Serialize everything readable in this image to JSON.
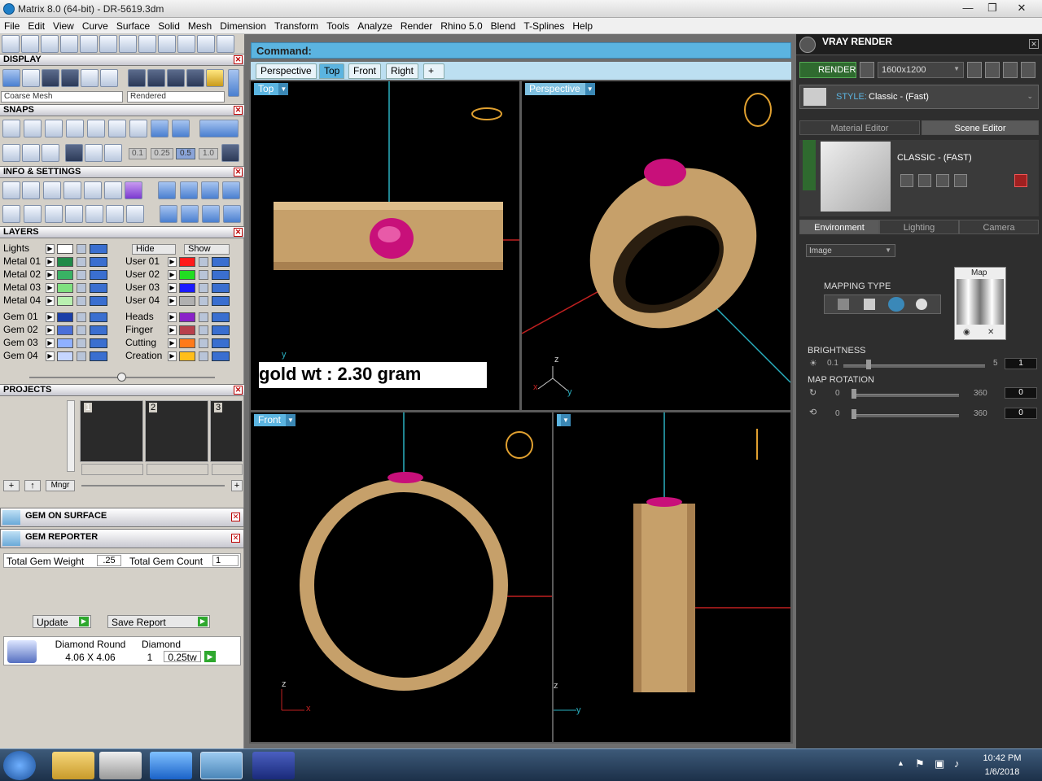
{
  "window": {
    "title": "Matrix 8.0 (64-bit) - DR-5619.3dm",
    "min": "—",
    "max": "❐",
    "close": "✕"
  },
  "menu": [
    "File",
    "Edit",
    "View",
    "Curve",
    "Surface",
    "Solid",
    "Mesh",
    "Dimension",
    "Transform",
    "Tools",
    "Analyze",
    "Render",
    "Rhino 5.0",
    "Blend",
    "T-Splines",
    "Help"
  ],
  "left": {
    "display": {
      "title": "DISPLAY",
      "mesh_option": "Coarse Mesh",
      "render_option": "Rendered"
    },
    "snaps": {
      "title": "SNAPS",
      "values": [
        "0.1",
        "0.25",
        "0.5",
        "1.0"
      ]
    },
    "info": {
      "title": "INFO & SETTINGS"
    },
    "layers": {
      "title": "LAYERS",
      "lights_label": "Lights",
      "hide_label": "Hide",
      "show_label": "Show",
      "left_rows": [
        {
          "name": "Metal 01",
          "color": "#1f8a48"
        },
        {
          "name": "Metal 02",
          "color": "#39b264"
        },
        {
          "name": "Metal 03",
          "color": "#7fe07f"
        },
        {
          "name": "Metal 04",
          "color": "#b9f0b0"
        },
        {
          "name": "Gem 01",
          "color": "#1b3fa8"
        },
        {
          "name": "Gem 02",
          "color": "#4a6fd8"
        },
        {
          "name": "Gem 03",
          "color": "#8fb0ff"
        },
        {
          "name": "Gem 04",
          "color": "#c6d6ff"
        }
      ],
      "right_rows": [
        {
          "name": "User 01",
          "color": "#ff1a1a"
        },
        {
          "name": "User 02",
          "color": "#22dd22"
        },
        {
          "name": "User 03",
          "color": "#1a1aff"
        },
        {
          "name": "User 04",
          "color": "#b0b0b0"
        },
        {
          "name": "Heads",
          "color": "#8a22c8"
        },
        {
          "name": "Finger",
          "color": "#b8404c"
        },
        {
          "name": "Cutting",
          "color": "#ff7a1a"
        },
        {
          "name": "Creation",
          "color": "#ffbe1a"
        }
      ]
    },
    "projects": {
      "title": "PROJECTS",
      "slots": [
        "1",
        "2",
        "3"
      ],
      "mngr_label": "Mngr"
    },
    "gem_on_surface": "GEM ON SURFACE",
    "gem_reporter": {
      "title": "GEM REPORTER",
      "total_weight_label": "Total Gem Weight",
      "total_weight_value": ".25",
      "total_count_label": "Total Gem Count",
      "total_count_value": "1",
      "update_label": "Update",
      "save_report_label": "Save Report",
      "row": {
        "name": "Diamond Round",
        "type": "Diamond",
        "size": "4.06 X 4.06",
        "qty": "1",
        "weight": "0.25tw"
      }
    }
  },
  "command": {
    "label": "Command:",
    "value": ""
  },
  "viewport_tabs": [
    "Perspective",
    "Top",
    "Front",
    "Right",
    "+"
  ],
  "viewports": {
    "top": {
      "label": "Top",
      "axis_label": "y"
    },
    "perspective": {
      "label": "Perspective",
      "axis_z": "z",
      "axis_y": "y",
      "axis_x": "x"
    },
    "front": {
      "label": "Front",
      "axis_z": "z",
      "axis_x": "x"
    },
    "right": {
      "label": "",
      "axis_z": "z",
      "axis_y": "y"
    },
    "overlay_text": "gold wt : 2.30 gram"
  },
  "vray": {
    "title": "VRAY RENDER",
    "render_label": "RENDER",
    "resolution": "1600x1200",
    "style_label": "STYLE:",
    "style_value": "Classic - (Fast)",
    "tabs": [
      "Material Editor",
      "Scene Editor"
    ],
    "preset_name": "CLASSIC - (FAST)",
    "subtabs": [
      "Environment",
      "Lighting",
      "Camera"
    ],
    "env_type": "Image",
    "map_label": "Map",
    "mapping_type_label": "MAPPING TYPE",
    "brightness": {
      "label": "BRIGHTNESS",
      "min": "0.1",
      "max": "5",
      "value": "1"
    },
    "map_rotation": {
      "label": "MAP ROTATION",
      "min1": "0",
      "max1": "360",
      "value1": "0",
      "min2": "0",
      "max2": "360",
      "value2": "0"
    }
  },
  "taskbar": {
    "time": "10:42 PM",
    "date": "1/6/2018"
  },
  "colors": {
    "gold": "#c8a46a",
    "ruby": "#c8107a",
    "viewport_bg": "#000000",
    "accent_blue": "#5bb4e0",
    "vray_green": "#2f6a2f"
  }
}
